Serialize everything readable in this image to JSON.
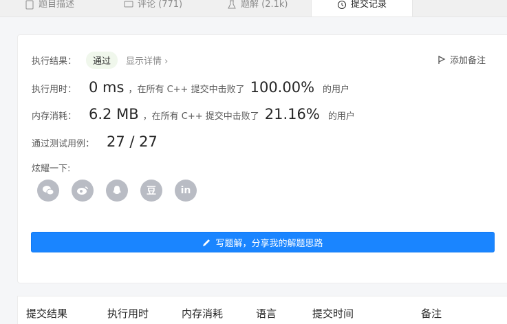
{
  "tabs": [
    {
      "label": "题目描述"
    },
    {
      "label": "评论 (771)"
    },
    {
      "label": "题解 (2.1k)"
    },
    {
      "label": "提交记录"
    }
  ],
  "result": {
    "label": "执行结果：",
    "status": "通过",
    "detail_link": "显示详情 ›",
    "add_note": "添加备注"
  },
  "runtime": {
    "label": "执行用时：",
    "value": "0 ms",
    "mid": "，在所有 C++ 提交中击败了",
    "percent": "100.00%",
    "suffix": "的用户"
  },
  "memory": {
    "label": "内存消耗：",
    "value": "6.2 MB",
    "mid": "，在所有 C++ 提交中击败了",
    "percent": "21.16%",
    "suffix": "的用户"
  },
  "tests": {
    "label": "通过测试用例：",
    "value": "27 / 27"
  },
  "share": {
    "label": "炫耀一下:",
    "icons": [
      {
        "name": "wechat-icon"
      },
      {
        "name": "weibo-icon"
      },
      {
        "name": "qq-icon"
      },
      {
        "name": "douban-icon",
        "glyph": "豆"
      },
      {
        "name": "linkedin-icon",
        "glyph": "in"
      }
    ]
  },
  "write_button": "写题解，分享我的解题思路",
  "table_headers": [
    "提交结果",
    "执行用时",
    "内存消耗",
    "语言",
    "提交时间",
    "备注"
  ],
  "colors": {
    "accent": "#1a85ff",
    "badge_bg": "#f0f7ec",
    "share_icon": "#b9bcc4"
  }
}
